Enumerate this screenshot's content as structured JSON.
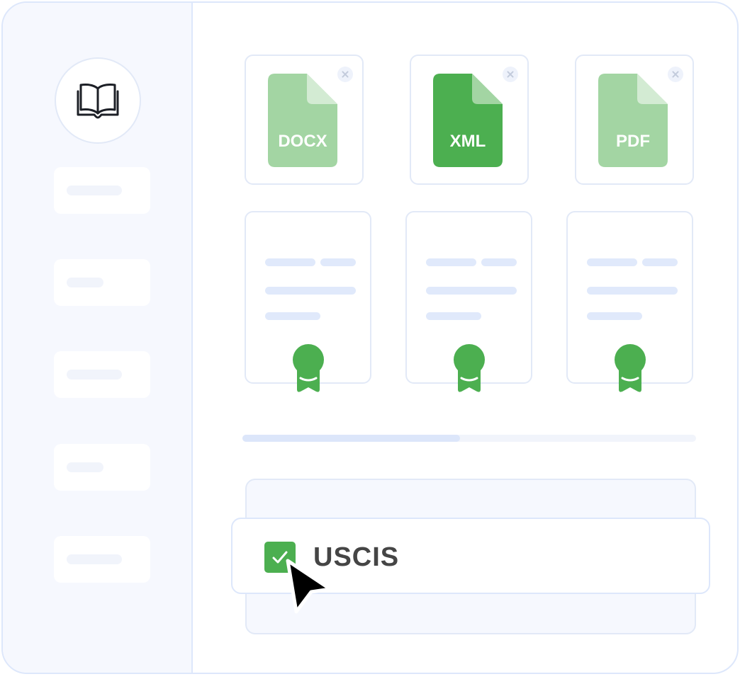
{
  "files": [
    {
      "label": "DOCX",
      "color": "#a3d5a3",
      "fold": "#d3ebd3",
      "selected": false
    },
    {
      "label": "XML",
      "color": "#4caf50",
      "fold": "#a3d5a3",
      "selected": true
    },
    {
      "label": "PDF",
      "color": "#a3d5a3",
      "fold": "#d3ebd3",
      "selected": false
    }
  ],
  "progress": {
    "value": 0.48
  },
  "checklist": {
    "label": "USCIS",
    "checked": true
  },
  "colors": {
    "accent": "#4caf50",
    "border": "#dde7fb",
    "sidebar": "#f6f8fe"
  },
  "icons": {
    "logo": "open-book-icon",
    "remove": "close-icon",
    "cursor": "mouse-pointer-icon"
  }
}
